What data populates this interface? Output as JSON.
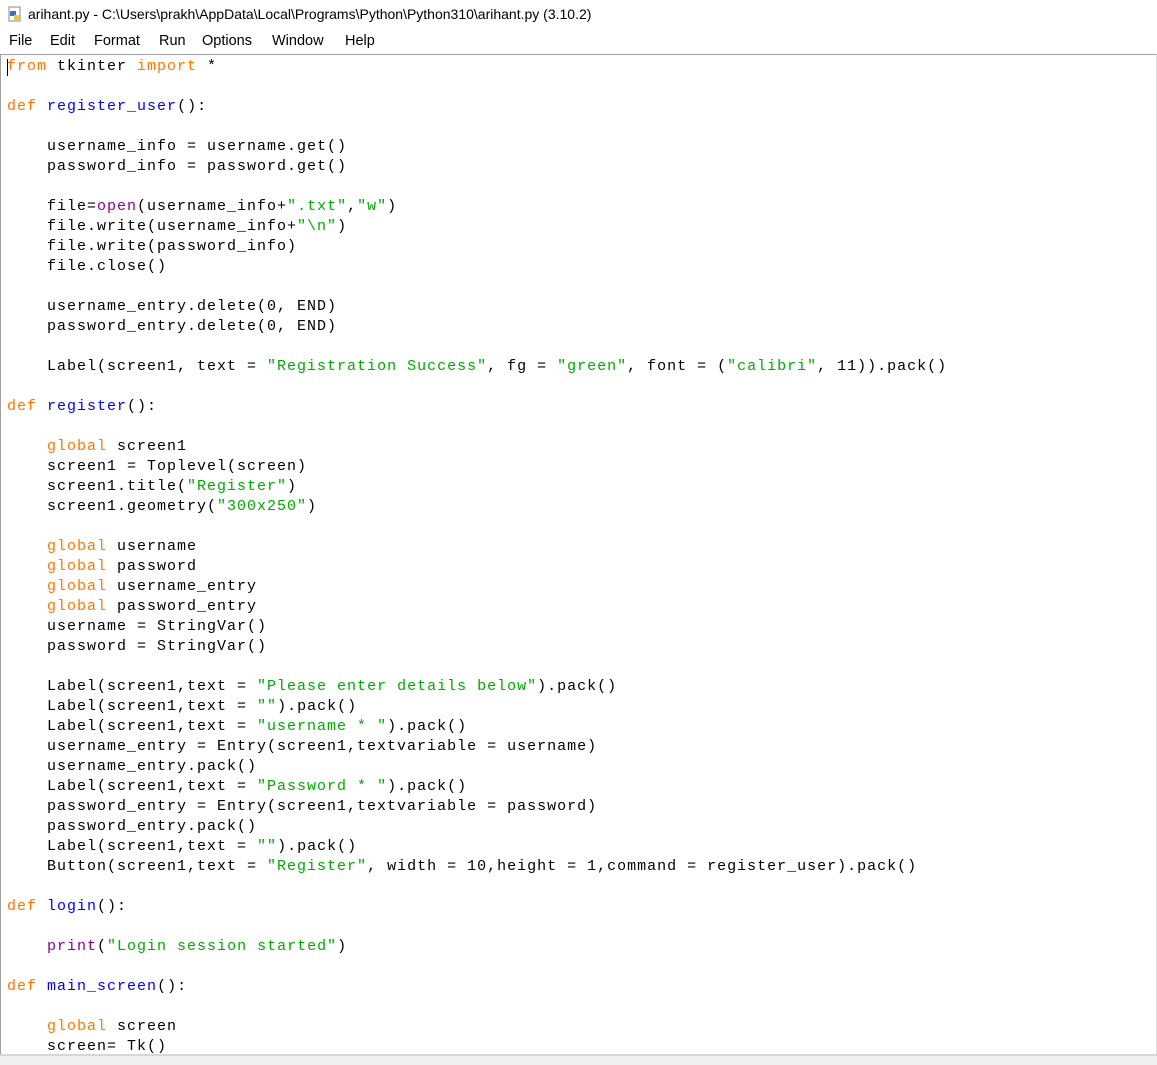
{
  "window": {
    "title": "arihant.py - C:\\Users\\prakh\\AppData\\Local\\Programs\\Python\\Python310\\arihant.py (3.10.2)",
    "icon": "python-file-icon"
  },
  "menu": [
    "File",
    "Edit",
    "Format",
    "Run",
    "Options",
    "Window",
    "Help"
  ],
  "colors": {
    "keyword": "#ff7700",
    "builtin": "#900090",
    "string": "#00aa00",
    "definition": "#0000ff"
  },
  "code": {
    "lines": [
      [
        [
          "k",
          "from"
        ],
        [
          "n",
          " tkinter "
        ],
        [
          "k",
          "import"
        ],
        [
          "n",
          " *"
        ]
      ],
      [],
      [
        [
          "k",
          "def"
        ],
        [
          "n",
          " "
        ],
        [
          "d",
          "register_user"
        ],
        [
          "n",
          "():"
        ]
      ],
      [],
      [
        [
          "n",
          "    username_info = username.get()"
        ]
      ],
      [
        [
          "n",
          "    password_info = password.get()"
        ]
      ],
      [],
      [
        [
          "n",
          "    file="
        ],
        [
          "b",
          "open"
        ],
        [
          "n",
          "(username_info+"
        ],
        [
          "s",
          "\".txt\""
        ],
        [
          "n",
          ","
        ],
        [
          "s",
          "\"w\""
        ],
        [
          "n",
          ")"
        ]
      ],
      [
        [
          "n",
          "    file.write(username_info+"
        ],
        [
          "s",
          "\"\\n\""
        ],
        [
          "n",
          ")"
        ]
      ],
      [
        [
          "n",
          "    file.write(password_info)"
        ]
      ],
      [
        [
          "n",
          "    file.close()"
        ]
      ],
      [],
      [
        [
          "n",
          "    username_entry.delete(0, END)"
        ]
      ],
      [
        [
          "n",
          "    password_entry.delete(0, END)"
        ]
      ],
      [],
      [
        [
          "n",
          "    Label(screen1, text = "
        ],
        [
          "s",
          "\"Registration Success\""
        ],
        [
          "n",
          ", fg = "
        ],
        [
          "s",
          "\"green\""
        ],
        [
          "n",
          ", font = ("
        ],
        [
          "s",
          "\"calibri\""
        ],
        [
          "n",
          ", 11)).pack()"
        ]
      ],
      [],
      [
        [
          "k",
          "def"
        ],
        [
          "n",
          " "
        ],
        [
          "d",
          "register"
        ],
        [
          "n",
          "():"
        ]
      ],
      [],
      [
        [
          "n",
          "    "
        ],
        [
          "k",
          "global"
        ],
        [
          "n",
          " screen1"
        ]
      ],
      [
        [
          "n",
          "    screen1 = Toplevel(screen)"
        ]
      ],
      [
        [
          "n",
          "    screen1.title("
        ],
        [
          "s",
          "\"Register\""
        ],
        [
          "n",
          ")"
        ]
      ],
      [
        [
          "n",
          "    screen1.geometry("
        ],
        [
          "s",
          "\"300x250\""
        ],
        [
          "n",
          ")"
        ]
      ],
      [],
      [
        [
          "n",
          "    "
        ],
        [
          "k",
          "global"
        ],
        [
          "n",
          " username"
        ]
      ],
      [
        [
          "n",
          "    "
        ],
        [
          "k",
          "global"
        ],
        [
          "n",
          " password"
        ]
      ],
      [
        [
          "n",
          "    "
        ],
        [
          "k",
          "global"
        ],
        [
          "n",
          " username_entry"
        ]
      ],
      [
        [
          "n",
          "    "
        ],
        [
          "k",
          "global"
        ],
        [
          "n",
          " password_entry"
        ]
      ],
      [
        [
          "n",
          "    username = StringVar()"
        ]
      ],
      [
        [
          "n",
          "    password = StringVar()"
        ]
      ],
      [],
      [
        [
          "n",
          "    Label(screen1,text = "
        ],
        [
          "s",
          "\"Please enter details below\""
        ],
        [
          "n",
          ").pack()"
        ]
      ],
      [
        [
          "n",
          "    Label(screen1,text = "
        ],
        [
          "s",
          "\"\""
        ],
        [
          "n",
          ").pack()"
        ]
      ],
      [
        [
          "n",
          "    Label(screen1,text = "
        ],
        [
          "s",
          "\"username * \""
        ],
        [
          "n",
          ").pack()"
        ]
      ],
      [
        [
          "n",
          "    username_entry = Entry(screen1,textvariable = username)"
        ]
      ],
      [
        [
          "n",
          "    username_entry.pack()"
        ]
      ],
      [
        [
          "n",
          "    Label(screen1,text = "
        ],
        [
          "s",
          "\"Password * \""
        ],
        [
          "n",
          ").pack()"
        ]
      ],
      [
        [
          "n",
          "    password_entry = Entry(screen1,textvariable = password)"
        ]
      ],
      [
        [
          "n",
          "    password_entry.pack()"
        ]
      ],
      [
        [
          "n",
          "    Label(screen1,text = "
        ],
        [
          "s",
          "\"\""
        ],
        [
          "n",
          ").pack()"
        ]
      ],
      [
        [
          "n",
          "    Button(screen1,text = "
        ],
        [
          "s",
          "\"Register\""
        ],
        [
          "n",
          ", width = 10,height = 1,command = register_user).pack()"
        ]
      ],
      [],
      [
        [
          "k",
          "def"
        ],
        [
          "n",
          " "
        ],
        [
          "d",
          "login"
        ],
        [
          "n",
          "():"
        ]
      ],
      [],
      [
        [
          "n",
          "    "
        ],
        [
          "b",
          "print"
        ],
        [
          "n",
          "("
        ],
        [
          "s",
          "\"Login session started\""
        ],
        [
          "n",
          ")"
        ]
      ],
      [],
      [
        [
          "k",
          "def"
        ],
        [
          "n",
          " "
        ],
        [
          "d",
          "main_screen"
        ],
        [
          "n",
          "():"
        ]
      ],
      [],
      [
        [
          "n",
          "    "
        ],
        [
          "k",
          "global"
        ],
        [
          "n",
          " screen"
        ]
      ],
      [
        [
          "n",
          "    screen= Tk()"
        ]
      ]
    ]
  }
}
